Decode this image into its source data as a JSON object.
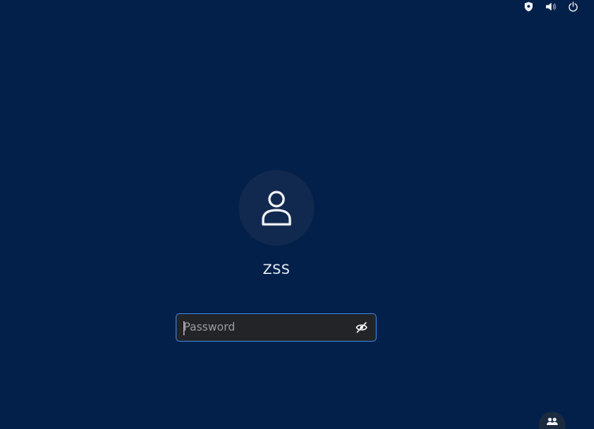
{
  "top_bar": {
    "icons": [
      "shield-icon",
      "volume-icon",
      "power-icon"
    ]
  },
  "login": {
    "avatar_icon": "user-icon",
    "username": "ZSS",
    "password_placeholder": "Password",
    "password_value": "",
    "reveal_icon": "eye-slash-icon"
  },
  "bottom": {
    "accessibility_icon": "users-icon"
  },
  "colors": {
    "background": "#03204a",
    "avatar_bg": "#11294f",
    "field_bg": "#222428",
    "field_border": "#3b83d8",
    "text": "#f2f4f7",
    "placeholder": "#9a9ca1"
  }
}
